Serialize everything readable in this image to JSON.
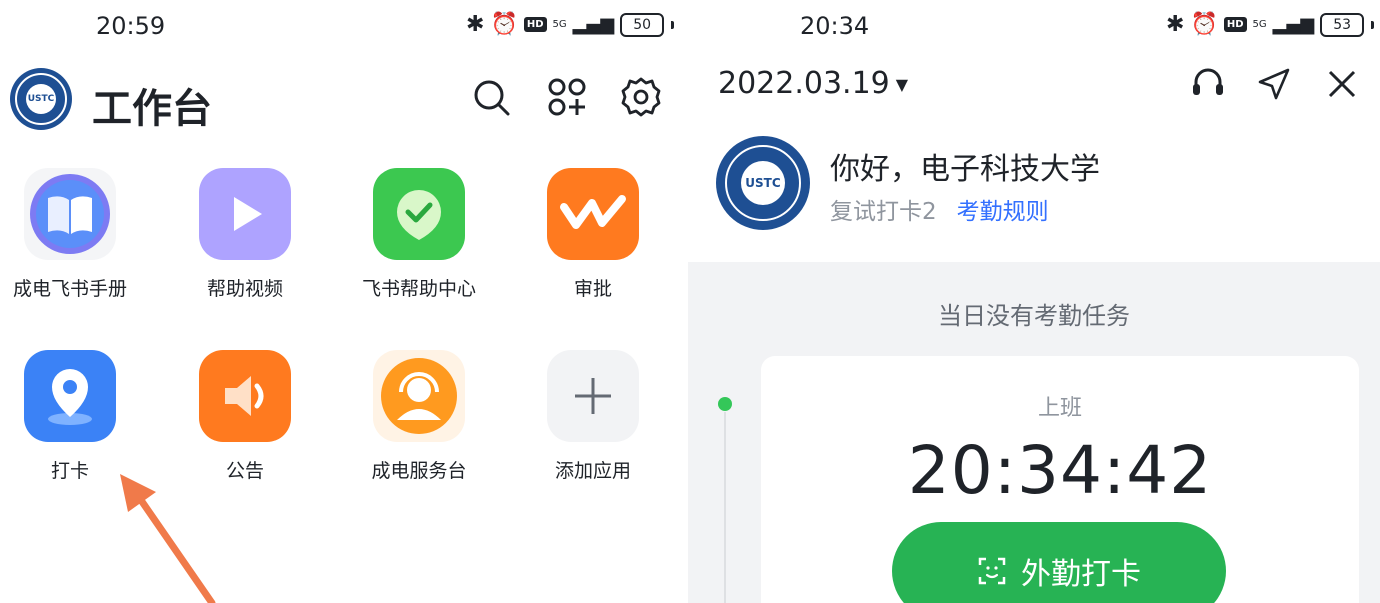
{
  "left": {
    "status": {
      "time": "20:59",
      "battery": "50",
      "network": "5G"
    },
    "header": {
      "title": "工作台",
      "logo_text": "USTC"
    },
    "apps": [
      {
        "label": "成电飞书手册",
        "icon": "book-icon",
        "color": "#5b7cf7"
      },
      {
        "label": "帮助视频",
        "icon": "play-icon",
        "color": "#a99bff"
      },
      {
        "label": "飞书帮助中心",
        "icon": "check-shield-icon",
        "color": "#34c759"
      },
      {
        "label": "审批",
        "icon": "approval-icon",
        "color": "#ff7a1f"
      },
      {
        "label": "打卡",
        "icon": "location-pin-icon",
        "color": "#3b82f6"
      },
      {
        "label": "公告",
        "icon": "speaker-icon",
        "color": "#ff7a1f"
      },
      {
        "label": "成电服务台",
        "icon": "customer-service-icon",
        "color": "#ff9a1f"
      },
      {
        "label": "添加应用",
        "icon": "plus-icon",
        "color": "#f2f3f5"
      }
    ],
    "annotation_color": "#f07a4a"
  },
  "right": {
    "status": {
      "time": "20:34",
      "battery": "53",
      "network": "5G"
    },
    "date": "2022.03.19",
    "greeting": "你好，电子科技大学",
    "group": "复试打卡2",
    "rules_link": "考勤规则",
    "no_task": "当日没有考勤任务",
    "shift": "上班",
    "clock": "20:34:42",
    "punch_button": "外勤打卡",
    "logo_text": "USTC"
  },
  "colors": {
    "accent": "#3370ff",
    "success": "#27b354"
  }
}
